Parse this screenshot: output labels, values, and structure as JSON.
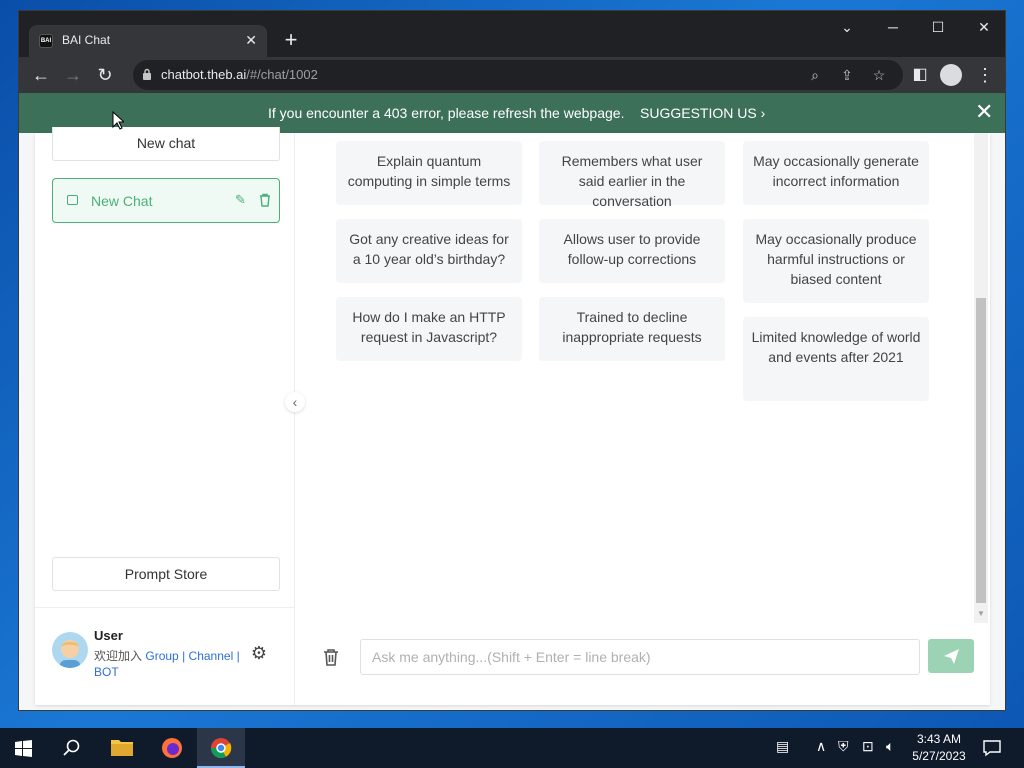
{
  "browser": {
    "tab_title": "BAI Chat",
    "tab_favicon_text": "BAI",
    "url_host": "chatbot.theb.ai",
    "url_path": "/#/chat/1002"
  },
  "banner": {
    "message": "If you encounter a 403 error, please refresh the webpage.",
    "suggestion_label": "SUGGESTION US"
  },
  "sidebar": {
    "new_chat_button": "New chat",
    "chats": [
      {
        "label": "New Chat"
      }
    ],
    "prompt_store_button": "Prompt Store",
    "user": {
      "name": "User",
      "join_text": "欢迎加入",
      "link_group": "Group",
      "link_channel": "Channel",
      "link_bot": "BOT",
      "sep": "|"
    }
  },
  "main": {
    "examples": [
      "Explain quantum computing in simple terms",
      "Got any creative ideas for a 10 year old’s birthday?",
      "How do I make an HTTP request in Javascript?"
    ],
    "capabilities": [
      "Remembers what user said earlier in the conversation",
      "Allows user to provide follow-up corrections",
      "Trained to decline inappropriate requests"
    ],
    "limitations": [
      "May occasionally generate incorrect information",
      "May occasionally produce harmful instructions or biased content",
      "Limited knowledge of world and events after 2021"
    ],
    "input_placeholder": "Ask me anything...(Shift + Enter = line break)"
  },
  "taskbar": {
    "time": "3:43 AM",
    "date": "5/27/2023"
  },
  "colors": {
    "banner": "#3c7059",
    "accent": "#4caf78",
    "send_button": "#9bd3b4",
    "link": "#2d6fd6"
  }
}
